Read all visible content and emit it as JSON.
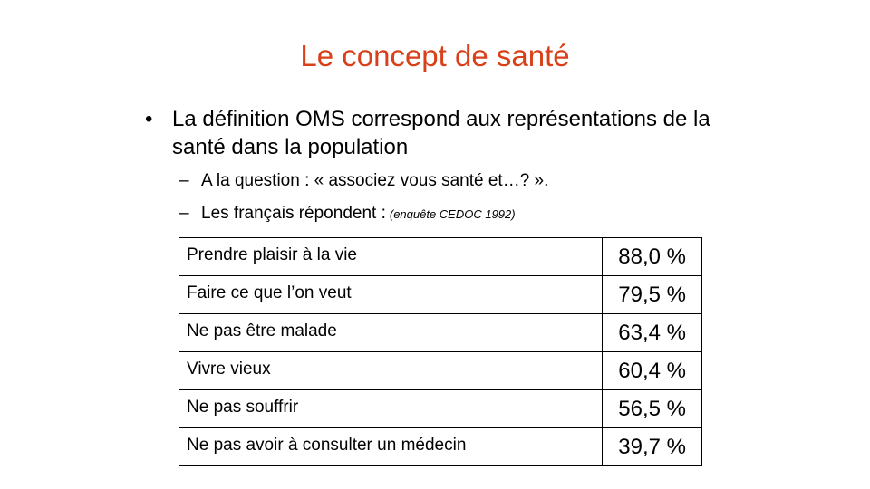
{
  "slide": {
    "title": "Le concept de santé",
    "bullet": "La définition OMS correspond aux représentations de la santé dans la population",
    "sub_items": [
      {
        "text": "A la question : « associez vous santé et…? ».",
        "note": ""
      },
      {
        "text": "Les français répondent :",
        "note": "(enquête CEDOC 1992)"
      }
    ],
    "table": {
      "rows": [
        {
          "label": "Prendre plaisir à la vie",
          "value": "88,0 %"
        },
        {
          "label": "Faire ce que l’on veut",
          "value": "79,5 %"
        },
        {
          "label": "Ne pas être malade",
          "value": "63,4 %"
        },
        {
          "label": "Vivre vieux",
          "value": "60,4 %"
        },
        {
          "label": "Ne pas souffrir",
          "value": "56,5 %"
        },
        {
          "label": "Ne pas avoir à consulter un médecin",
          "value": "39,7 %"
        }
      ]
    },
    "glyphs": {
      "bullet": "•",
      "dash": "–"
    },
    "colors": {
      "title": "#d9401a",
      "text": "#000000",
      "background": "#ffffff"
    }
  }
}
